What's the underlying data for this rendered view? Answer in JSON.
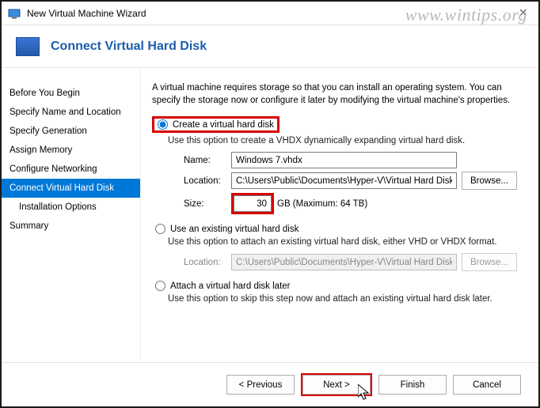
{
  "window": {
    "title": "New Virtual Machine Wizard"
  },
  "watermark": "www.wintips.org",
  "heading": "Connect Virtual Hard Disk",
  "nav": {
    "items": [
      {
        "label": "Before You Begin",
        "active": false,
        "sub": false
      },
      {
        "label": "Specify Name and Location",
        "active": false,
        "sub": false
      },
      {
        "label": "Specify Generation",
        "active": false,
        "sub": false
      },
      {
        "label": "Assign Memory",
        "active": false,
        "sub": false
      },
      {
        "label": "Configure Networking",
        "active": false,
        "sub": false
      },
      {
        "label": "Connect Virtual Hard Disk",
        "active": true,
        "sub": false
      },
      {
        "label": "Installation Options",
        "active": false,
        "sub": true
      },
      {
        "label": "Summary",
        "active": false,
        "sub": false
      }
    ]
  },
  "main": {
    "intro": "A virtual machine requires storage so that you can install an operating system. You can specify the storage now or configure it later by modifying the virtual machine's properties.",
    "opt_create": {
      "label": "Create a virtual hard disk",
      "hint": "Use this option to create a VHDX dynamically expanding virtual hard disk.",
      "name_label": "Name:",
      "name_value": "Windows 7.vhdx",
      "location_label": "Location:",
      "location_value": "C:\\Users\\Public\\Documents\\Hyper-V\\Virtual Hard Disks\\",
      "browse": "Browse...",
      "size_label": "Size:",
      "size_value": "30",
      "size_unit": "GB (Maximum: 64 TB)"
    },
    "opt_existing": {
      "label": "Use an existing virtual hard disk",
      "hint": "Use this option to attach an existing virtual hard disk, either VHD or VHDX format.",
      "location_label": "Location:",
      "location_value": "C:\\Users\\Public\\Documents\\Hyper-V\\Virtual Hard Disks\\",
      "browse": "Browse..."
    },
    "opt_later": {
      "label": "Attach a virtual hard disk later",
      "hint": "Use this option to skip this step now and attach an existing virtual hard disk later."
    }
  },
  "footer": {
    "previous": "< Previous",
    "next": "Next >",
    "finish": "Finish",
    "cancel": "Cancel"
  }
}
